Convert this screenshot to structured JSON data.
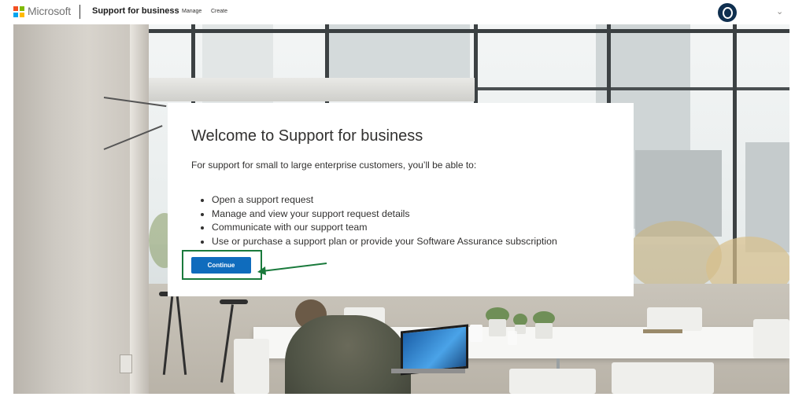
{
  "header": {
    "brand": "Microsoft",
    "product": "Support for business",
    "nav": [
      "Manage",
      "Create"
    ],
    "logo_colors": [
      "#f25022",
      "#7fba00",
      "#00a4ef",
      "#ffb900"
    ],
    "avatar_icon": "avatar-icon",
    "menu_icon": "chevron-down-icon"
  },
  "card": {
    "title": "Welcome to Support for business",
    "description": "For support for small to large enterprise customers, you’ll be able to:",
    "items": [
      "Open a support request",
      "Manage and view your support request details",
      "Communicate with our support team",
      "Use or purchase a support plan or provide your Software Assurance subscription"
    ],
    "button_label": "Continue"
  },
  "annotation": {
    "highlight_color": "#1a7a3c"
  },
  "colors": {
    "primary": "#0f6cbd",
    "text": "#323130"
  }
}
